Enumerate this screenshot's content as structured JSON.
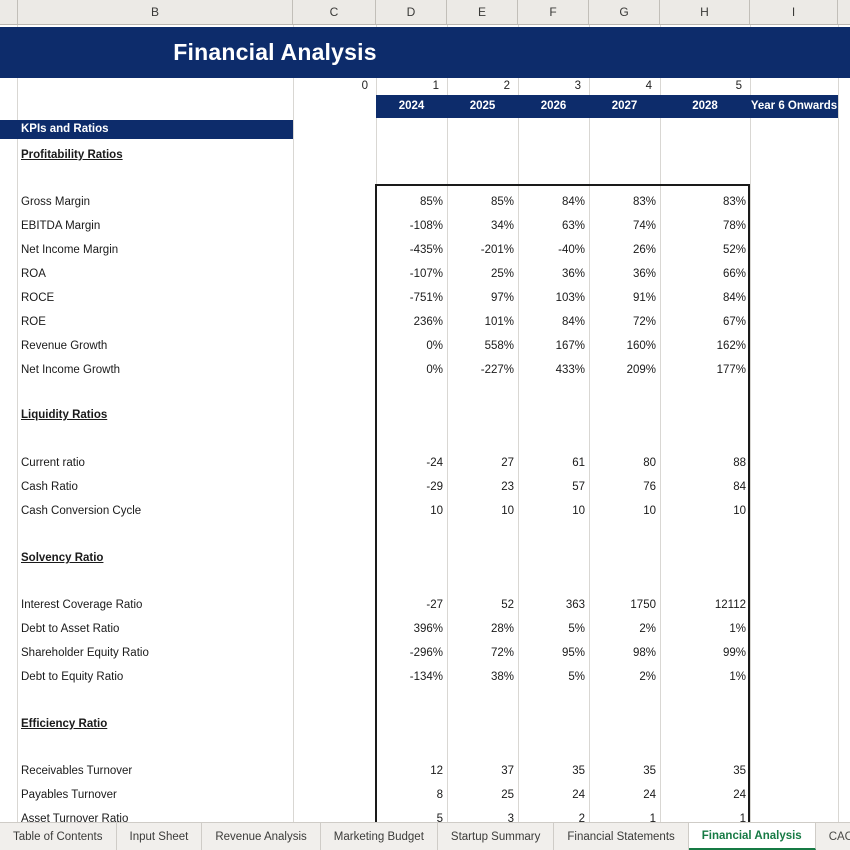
{
  "app": {
    "title": "Financial Analysis"
  },
  "columns": {
    "letters": [
      "B",
      "C",
      "D",
      "E",
      "F",
      "G",
      "H",
      "I"
    ]
  },
  "header": {
    "banner_title": "Financial Analysis",
    "year_indices": [
      "0",
      "1",
      "2",
      "3",
      "4",
      "5"
    ],
    "year_labels": [
      "2024",
      "2025",
      "2026",
      "2027",
      "2028",
      "Year 6 Onwards"
    ]
  },
  "section": {
    "title": "KPIs and Ratios"
  },
  "groups": [
    {
      "heading": "Profitability Ratios",
      "rows": [
        {
          "label": "Gross Margin",
          "values": [
            "85%",
            "85%",
            "84%",
            "83%",
            "83%"
          ]
        },
        {
          "label": "EBITDA Margin",
          "values": [
            "-108%",
            "34%",
            "63%",
            "74%",
            "78%"
          ]
        },
        {
          "label": "Net Income Margin",
          "values": [
            "-435%",
            "-201%",
            "-40%",
            "26%",
            "52%"
          ]
        },
        {
          "label": "ROA",
          "values": [
            "-107%",
            "25%",
            "36%",
            "36%",
            "66%"
          ]
        },
        {
          "label": "ROCE",
          "values": [
            "-751%",
            "97%",
            "103%",
            "91%",
            "84%"
          ]
        },
        {
          "label": "ROE",
          "values": [
            "236%",
            "101%",
            "84%",
            "72%",
            "67%"
          ]
        },
        {
          "label": "Revenue Growth",
          "values": [
            "0%",
            "558%",
            "167%",
            "160%",
            "162%"
          ]
        },
        {
          "label": "Net Income Growth",
          "values": [
            "0%",
            "-227%",
            "433%",
            "209%",
            "177%"
          ]
        }
      ]
    },
    {
      "heading": "Liquidity Ratios",
      "rows": [
        {
          "label": "Current ratio",
          "values": [
            "-24",
            "27",
            "61",
            "80",
            "88"
          ]
        },
        {
          "label": "Cash Ratio",
          "values": [
            "-29",
            "23",
            "57",
            "76",
            "84"
          ]
        },
        {
          "label": "Cash Conversion Cycle",
          "values": [
            "10",
            "10",
            "10",
            "10",
            "10"
          ]
        }
      ]
    },
    {
      "heading": "Solvency Ratio",
      "rows": [
        {
          "label": "Interest Coverage Ratio",
          "values": [
            "-27",
            "52",
            "363",
            "1750",
            "12112"
          ]
        },
        {
          "label": "Debt to Asset Ratio",
          "values": [
            "396%",
            "28%",
            "5%",
            "2%",
            "1%"
          ]
        },
        {
          "label": "Shareholder Equity Ratio",
          "values": [
            "-296%",
            "72%",
            "95%",
            "98%",
            "99%"
          ]
        },
        {
          "label": "Debt to Equity Ratio",
          "values": [
            "-134%",
            "38%",
            "5%",
            "2%",
            "1%"
          ]
        }
      ]
    },
    {
      "heading": "Efficiency Ratio",
      "rows": [
        {
          "label": "Receivables Turnover",
          "values": [
            "12",
            "37",
            "35",
            "35",
            "35"
          ]
        },
        {
          "label": "Payables Turnover",
          "values": [
            "8",
            "25",
            "24",
            "24",
            "24"
          ]
        },
        {
          "label": "Asset Turnover Ratio",
          "values": [
            "5",
            "3",
            "2",
            "1",
            "1"
          ]
        }
      ]
    }
  ],
  "tabs": [
    {
      "label": "Table of Contents",
      "active": false
    },
    {
      "label": "Input Sheet",
      "active": false
    },
    {
      "label": "Revenue Analysis",
      "active": false
    },
    {
      "label": "Marketing Budget",
      "active": false
    },
    {
      "label": "Startup Summary",
      "active": false
    },
    {
      "label": "Financial Statements",
      "active": false
    },
    {
      "label": "Financial Analysis",
      "active": true
    },
    {
      "label": "CAC - CL\\",
      "active": false
    }
  ],
  "tab_overflow": "...",
  "colors": {
    "brand_blue": "#0d2c6b",
    "active_tab_green": "#167a44",
    "header_grey": "#eceae6"
  }
}
